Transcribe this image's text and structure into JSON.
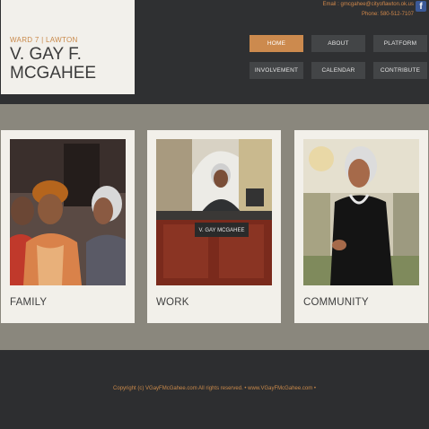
{
  "logo": {
    "ward": "WARD 7 | LAWTON",
    "name": "V. GAY F. MCGAHEE"
  },
  "contact": {
    "email": "Email : gmcgahee@cityoflawton.ok.us",
    "phone": "Phone: 580-512-7107",
    "social_icon": "facebook-icon",
    "social_glyph": "f"
  },
  "nav": {
    "items": [
      {
        "label": "HOME",
        "active": true
      },
      {
        "label": "ABOUT"
      },
      {
        "label": "PLATFORM"
      },
      {
        "label": "INVOLVEMENT"
      },
      {
        "label": "CALENDAR"
      },
      {
        "label": "CONTRIBUTE"
      }
    ]
  },
  "cards": [
    {
      "label": "FAMILY"
    },
    {
      "label": "WORK",
      "podium_plate": "V. GAY MCGAHEE"
    },
    {
      "label": "COMMUNITY"
    }
  ],
  "footer": {
    "copyright": "Copyright (c) VGayFMcGahee.com All rights reserved. • www.VGayFMcGahee.com •"
  },
  "colors": {
    "accent": "#cc8a4e",
    "header_bg": "#2f3032",
    "band_bg": "#8a877d",
    "card_bg": "#f2f0ea"
  }
}
